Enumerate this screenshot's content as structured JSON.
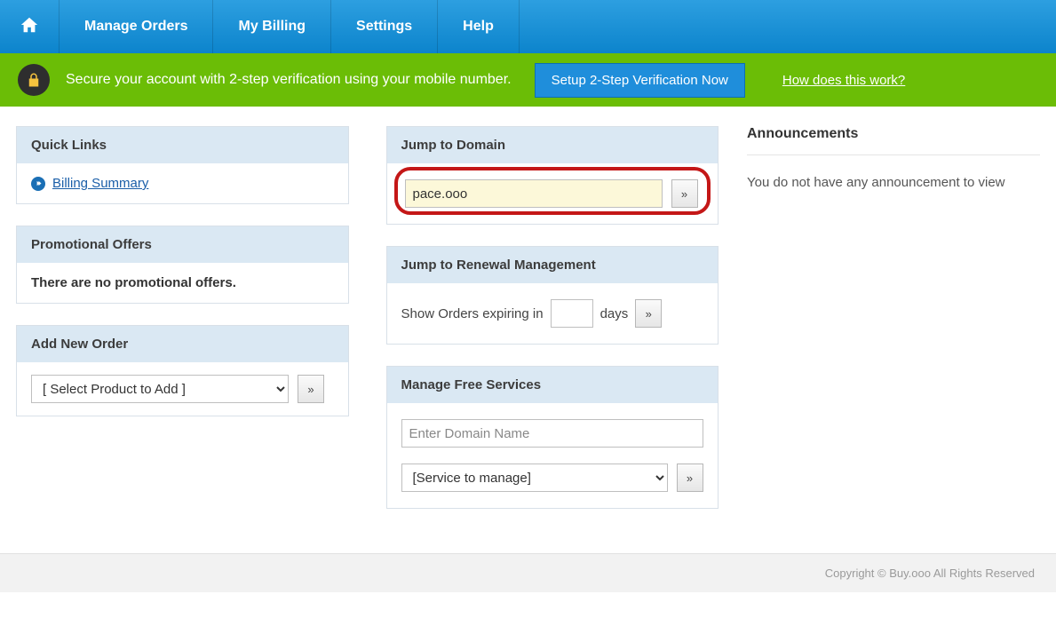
{
  "nav": {
    "manage_orders": "Manage Orders",
    "my_billing": "My Billing",
    "settings": "Settings",
    "help": "Help"
  },
  "alert": {
    "text": "Secure your account with 2-step verification using your mobile number.",
    "button": "Setup 2-Step Verification Now",
    "link": "How does this work?"
  },
  "quick_links": {
    "title": "Quick Links",
    "billing_summary": "Billing Summary"
  },
  "promo": {
    "title": "Promotional Offers",
    "none": "There are no promotional offers."
  },
  "add_order": {
    "title": "Add New Order",
    "select_placeholder": "[ Select Product to Add ]",
    "go": "»"
  },
  "jump_domain": {
    "title": "Jump to Domain",
    "value": "pace.ooo",
    "go": "»"
  },
  "renewal": {
    "title": "Jump to Renewal Management",
    "prefix": "Show Orders expiring in",
    "suffix": "days",
    "go": "»",
    "value": ""
  },
  "mfs": {
    "title": "Manage Free Services",
    "domain_placeholder": "Enter Domain Name",
    "service_placeholder": "[Service to manage]",
    "go": "»"
  },
  "announcements": {
    "title": "Announcements",
    "none": "You do not have any announcement to view"
  },
  "footer": {
    "copyright": "Copyright © Buy.ooo All Rights Reserved"
  }
}
